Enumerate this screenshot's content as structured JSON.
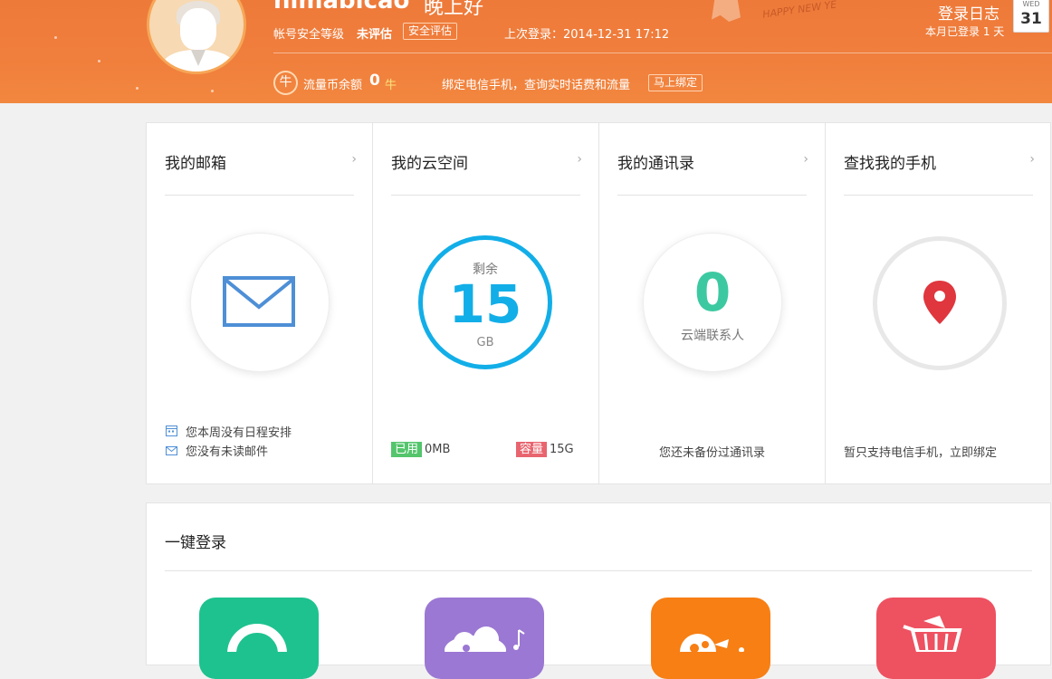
{
  "header": {
    "username": "nimabicao",
    "greeting": "晚上好",
    "account_security_label": "帐号安全等级",
    "account_security_level": "未评估",
    "security_eval_button": "安全评估",
    "last_login_label": "上次登录：",
    "last_login_time": "2014-12-31 17:12",
    "coin_icon_glyph": "牛",
    "coin_balance_label": "流量币余额",
    "coin_balance_value": "0",
    "coin_unit": "牛",
    "bind_phone_text": "绑定电信手机，查询实时话费和流量",
    "bind_phone_button": "马上绑定",
    "decoration_text": "HAPPY NEW YE",
    "login_log_title": "登录日志",
    "login_log_sub": "本月已登录 1 天",
    "calendar_weekday": "WED",
    "calendar_day": "31"
  },
  "cards": {
    "mail": {
      "title": "我的邮箱",
      "schedule_note": "您本周没有日程安排",
      "unread_note": "您没有未读邮件"
    },
    "cloud": {
      "title": "我的云空间",
      "remaining_label": "剩余",
      "remaining_value": "15",
      "remaining_unit": "GB",
      "used_tag": "已用",
      "used_value": "0MB",
      "capacity_tag": "容量",
      "capacity_value": "15G"
    },
    "contacts": {
      "title": "我的通讯录",
      "count": "0",
      "count_label": "云端联系人",
      "backup_note": "您还未备份过通讯录"
    },
    "phone": {
      "title": "查找我的手机",
      "support_note": "暂只支持电信手机，立即绑定"
    },
    "arrow_glyph": "›"
  },
  "quick_login": {
    "title": "一键登录",
    "apps": [
      {
        "name": "location-app",
        "color": "#1ec28f"
      },
      {
        "name": "cloud-music-app",
        "color": "#9b78d3"
      },
      {
        "name": "orange-app",
        "color": "#f77f14"
      },
      {
        "name": "shopping-app",
        "color": "#ee5160"
      }
    ]
  },
  "colors": {
    "header_orange": "#f07e3c",
    "cloud_blue": "#12aee8",
    "contacts_green": "#3cc9a1",
    "used_green": "#54c56c",
    "capacity_red": "#e8646e",
    "location_red": "#e0363e"
  }
}
